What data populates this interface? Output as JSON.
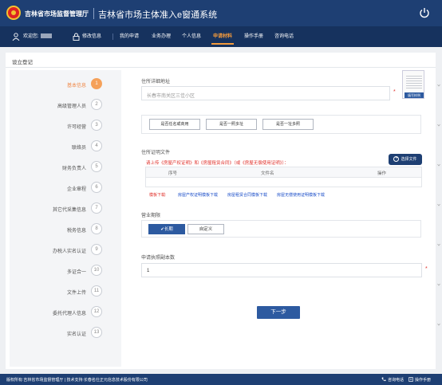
{
  "header": {
    "org_name": "吉林省市场监督管理厅",
    "system_title": "吉林省市场主体准入e窗通系统"
  },
  "nav": {
    "welcome": "欢迎您:",
    "change_info": "修改信息",
    "items": [
      "我的申请",
      "业务办理",
      "个人信息",
      "申请材料",
      "操作手册",
      "咨询电话"
    ],
    "active_index": 3
  },
  "panel": {
    "title": "设立登记"
  },
  "steps": [
    {
      "label": "基本信息",
      "num": "1",
      "active": true
    },
    {
      "label": "高级管理人员",
      "num": "2"
    },
    {
      "label": "许可经营",
      "num": "3"
    },
    {
      "label": "联络员",
      "num": "4"
    },
    {
      "label": "财务负责人",
      "num": "5"
    },
    {
      "label": "企业章程",
      "num": "6"
    },
    {
      "label": "其它代采集信息",
      "num": "7"
    },
    {
      "label": "税务信息",
      "num": "8"
    },
    {
      "label": "办税人实名认证",
      "num": "9"
    },
    {
      "label": "多证合一",
      "num": "10"
    },
    {
      "label": "文件上传",
      "num": "11"
    },
    {
      "label": "委托代理人信息",
      "num": "12"
    },
    {
      "label": "实名认证",
      "num": "13"
    }
  ],
  "address": {
    "label": "住所详细地址",
    "placeholder": "长春市南关区三佳小区",
    "required_mark": "*",
    "sample_button": "填写样例",
    "buttons": [
      "是否任名或商用",
      "是否一照多址",
      "是否一址多照"
    ]
  },
  "certificate": {
    "label": "住所证明文件",
    "upload_button": "选择文件",
    "instruction": "请上传《房屋产权证明》和《房屋租赁合同》（或《房屋无偿使用证明》）：",
    "columns": [
      "序号",
      "文件名",
      "操作"
    ],
    "template_label": "模板下载:",
    "template_links": [
      "房屋产权证明模板下载",
      "房屋租赁合同模板下载",
      "房屋无偿使用证明模板下载"
    ]
  },
  "term": {
    "label": "营业期限",
    "options": [
      "✔长期",
      "自定义"
    ],
    "selected": 0
  },
  "copies": {
    "label": "申请执照副本数",
    "value": "1",
    "required_mark": "*"
  },
  "next_button": "下一步",
  "footer": {
    "copyright": "版权所有:吉林省市场监督管理厅 | 技术支持:长春名仕正元信息技术股份有限公司",
    "phone": "咨询电话",
    "manual": "操作手册"
  },
  "colors": {
    "header_bg": "#1e3f73",
    "nav_bg": "#16325e",
    "accent": "#f39a3c",
    "primary_button": "#2d5aa0",
    "warning": "#e0302a",
    "link": "#1b4ec9"
  }
}
